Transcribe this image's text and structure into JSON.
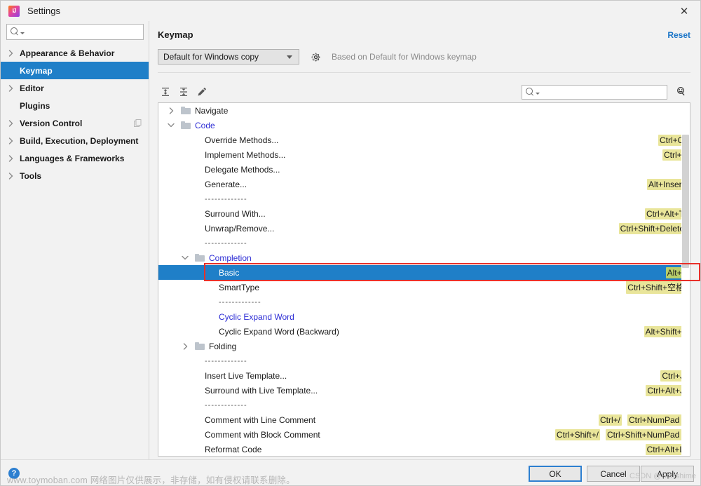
{
  "window": {
    "title": "Settings",
    "logo_icon": "intellij-idea-logo",
    "close_icon": "close-icon"
  },
  "sidebar": {
    "search": {
      "value": "",
      "placeholder": "",
      "icon": "search-icon"
    },
    "items": [
      {
        "label": "Appearance & Behavior",
        "expandable": true,
        "selected": false,
        "trailing_icon": ""
      },
      {
        "label": "Keymap",
        "expandable": false,
        "selected": true,
        "trailing_icon": ""
      },
      {
        "label": "Editor",
        "expandable": true,
        "selected": false,
        "trailing_icon": ""
      },
      {
        "label": "Plugins",
        "expandable": false,
        "selected": false,
        "trailing_icon": ""
      },
      {
        "label": "Version Control",
        "expandable": true,
        "selected": false,
        "trailing_icon": "copy-icon"
      },
      {
        "label": "Build, Execution, Deployment",
        "expandable": true,
        "selected": false,
        "trailing_icon": ""
      },
      {
        "label": "Languages & Frameworks",
        "expandable": true,
        "selected": false,
        "trailing_icon": ""
      },
      {
        "label": "Tools",
        "expandable": true,
        "selected": false,
        "trailing_icon": ""
      }
    ]
  },
  "content": {
    "page_title": "Keymap",
    "reset_label": "Reset",
    "keymap_select": {
      "value": "Default for Windows copy"
    },
    "gear_icon": "gear-icon",
    "based_on": "Based on Default for Windows keymap",
    "toolbar": {
      "expand_all_icon": "expand-all-icon",
      "collapse_all_icon": "collapse-all-icon",
      "edit_icon": "edit-pencil-icon",
      "search": {
        "value": "",
        "placeholder": "",
        "icon": "search-icon"
      },
      "filter_by_shortcut_icon": "find-by-shortcut-icon"
    }
  },
  "tree": {
    "rows": [
      {
        "kind": "folder",
        "depth": 0,
        "arrow": "right",
        "label": "Navigate",
        "link": false,
        "keys": []
      },
      {
        "kind": "folder",
        "depth": 0,
        "arrow": "down",
        "label": "Code",
        "link": true,
        "keys": []
      },
      {
        "kind": "action",
        "depth": 1,
        "arrow": "none",
        "label": "Override Methods...",
        "link": false,
        "keys": [
          "Ctrl+O"
        ]
      },
      {
        "kind": "action",
        "depth": 1,
        "arrow": "none",
        "label": "Implement Methods...",
        "link": false,
        "keys": [
          "Ctrl+I"
        ]
      },
      {
        "kind": "action",
        "depth": 1,
        "arrow": "none",
        "label": "Delegate Methods...",
        "link": false,
        "keys": []
      },
      {
        "kind": "action",
        "depth": 1,
        "arrow": "none",
        "label": "Generate...",
        "link": false,
        "keys": [
          "Alt+Insert"
        ]
      },
      {
        "kind": "separator",
        "depth": 1,
        "arrow": "none",
        "label": "-------------",
        "link": false,
        "keys": []
      },
      {
        "kind": "action",
        "depth": 1,
        "arrow": "none",
        "label": "Surround With...",
        "link": false,
        "keys": [
          "Ctrl+Alt+T"
        ]
      },
      {
        "kind": "action",
        "depth": 1,
        "arrow": "none",
        "label": "Unwrap/Remove...",
        "link": false,
        "keys": [
          "Ctrl+Shift+Delete"
        ]
      },
      {
        "kind": "separator",
        "depth": 1,
        "arrow": "none",
        "label": "-------------",
        "link": false,
        "keys": []
      },
      {
        "kind": "folder",
        "depth": 1,
        "arrow": "down",
        "label": "Completion",
        "link": true,
        "keys": []
      },
      {
        "kind": "action",
        "depth": 2,
        "arrow": "none",
        "label": "Basic",
        "link": false,
        "keys": [
          "Alt+/"
        ],
        "selected": true,
        "annotated": true
      },
      {
        "kind": "action",
        "depth": 2,
        "arrow": "none",
        "label": "SmartType",
        "link": false,
        "keys": [
          "Ctrl+Shift+空格"
        ]
      },
      {
        "kind": "separator",
        "depth": 2,
        "arrow": "none",
        "label": "-------------",
        "link": false,
        "keys": []
      },
      {
        "kind": "action",
        "depth": 2,
        "arrow": "none",
        "label": "Cyclic Expand Word",
        "link": true,
        "keys": []
      },
      {
        "kind": "action",
        "depth": 2,
        "arrow": "none",
        "label": "Cyclic Expand Word (Backward)",
        "link": false,
        "keys": [
          "Alt+Shift+/"
        ]
      },
      {
        "kind": "folder",
        "depth": 1,
        "arrow": "right",
        "label": "Folding",
        "link": false,
        "keys": []
      },
      {
        "kind": "separator",
        "depth": 1,
        "arrow": "none",
        "label": "-------------",
        "link": false,
        "keys": []
      },
      {
        "kind": "action",
        "depth": 1,
        "arrow": "none",
        "label": "Insert Live Template...",
        "link": false,
        "keys": [
          "Ctrl+J"
        ]
      },
      {
        "kind": "action",
        "depth": 1,
        "arrow": "none",
        "label": "Surround with Live Template...",
        "link": false,
        "keys": [
          "Ctrl+Alt+J"
        ]
      },
      {
        "kind": "separator",
        "depth": 1,
        "arrow": "none",
        "label": "-------------",
        "link": false,
        "keys": []
      },
      {
        "kind": "action",
        "depth": 1,
        "arrow": "none",
        "label": "Comment with Line Comment",
        "link": false,
        "keys": [
          "Ctrl+/",
          "Ctrl+NumPad /"
        ]
      },
      {
        "kind": "action",
        "depth": 1,
        "arrow": "none",
        "label": "Comment with Block Comment",
        "link": false,
        "keys": [
          "Ctrl+Shift+/",
          "Ctrl+Shift+NumPad /"
        ]
      },
      {
        "kind": "action",
        "depth": 1,
        "arrow": "none",
        "label": "Reformat Code",
        "link": false,
        "keys": [
          "Ctrl+Alt+L"
        ]
      }
    ]
  },
  "footer": {
    "help_label": "?",
    "ok_label": "OK",
    "cancel_label": "Cancel",
    "apply_label": "Apply"
  },
  "watermarks": {
    "bottom": "www.toymoban.com 网络图片仅供展示，非存储，如有侵权请联系删除。",
    "csdn": "CSDN @Starshime"
  },
  "colors": {
    "selection_blue": "#1f7fc8",
    "link_blue": "#2b2bd4",
    "reset_blue": "#1773c7",
    "shortcut_highlight": "#e9e59a",
    "shortcut_highlight_selected": "#b9cf6a",
    "annotation_red": "#e8302a"
  }
}
